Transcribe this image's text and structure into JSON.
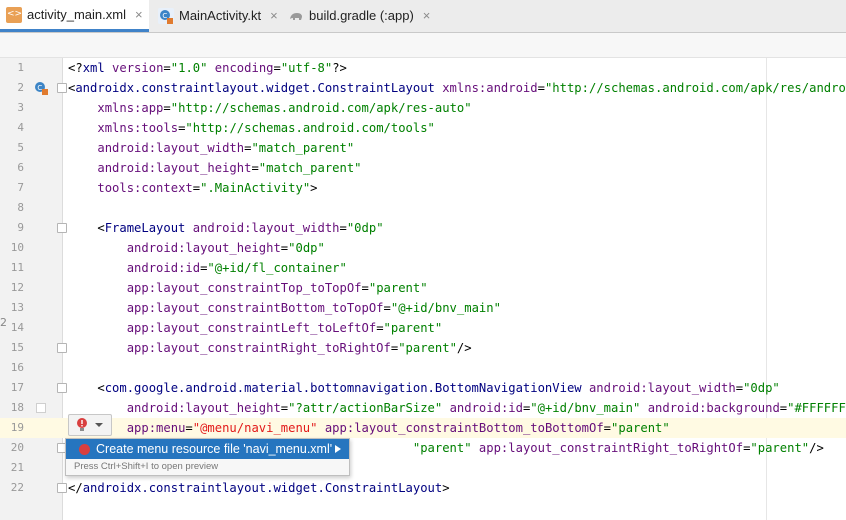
{
  "tabs": [
    {
      "label": "activity_main.xml",
      "icon": "xml-file-icon",
      "active": true
    },
    {
      "label": "MainActivity.kt",
      "icon": "kotlin-class-icon",
      "active": false
    },
    {
      "label": "build.gradle (:app)",
      "icon": "gradle-icon",
      "active": false
    }
  ],
  "close_glyph": "×",
  "lines": [
    {
      "n": "1",
      "tokens": [
        [
          "t",
          "<?"
        ],
        [
          "tag",
          "xml "
        ],
        [
          "attr",
          "version"
        ],
        [
          "t",
          "="
        ],
        [
          "val",
          "\"1.0\""
        ],
        [
          "t",
          " "
        ],
        [
          "attr",
          "encoding"
        ],
        [
          "t",
          "="
        ],
        [
          "val",
          "\"utf-8\""
        ],
        [
          "t",
          "?>"
        ]
      ]
    },
    {
      "n": "2",
      "tokens": [
        [
          "t",
          "<"
        ],
        [
          "tag",
          "androidx.constraintlayout.widget.ConstraintLayout "
        ],
        [
          "attr",
          "xmlns:android"
        ],
        [
          "t",
          "="
        ],
        [
          "val",
          "\"http://schemas.android.com/apk/res/android\""
        ]
      ]
    },
    {
      "n": "3",
      "tokens": [
        [
          "t",
          "    "
        ],
        [
          "attr",
          "xmlns:app"
        ],
        [
          "t",
          "="
        ],
        [
          "val",
          "\"http://schemas.android.com/apk/res-auto\""
        ]
      ]
    },
    {
      "n": "4",
      "tokens": [
        [
          "t",
          "    "
        ],
        [
          "attr",
          "xmlns:tools"
        ],
        [
          "t",
          "="
        ],
        [
          "val",
          "\"http://schemas.android.com/tools\""
        ]
      ]
    },
    {
      "n": "5",
      "tokens": [
        [
          "t",
          "    "
        ],
        [
          "attr",
          "android:layout_width"
        ],
        [
          "t",
          "="
        ],
        [
          "val",
          "\"match_parent\""
        ]
      ]
    },
    {
      "n": "6",
      "tokens": [
        [
          "t",
          "    "
        ],
        [
          "attr",
          "android:layout_height"
        ],
        [
          "t",
          "="
        ],
        [
          "val",
          "\"match_parent\""
        ]
      ]
    },
    {
      "n": "7",
      "tokens": [
        [
          "t",
          "    "
        ],
        [
          "attr",
          "tools:context"
        ],
        [
          "t",
          "="
        ],
        [
          "val",
          "\".MainActivity\""
        ],
        [
          "t",
          ">"
        ]
      ]
    },
    {
      "n": "8",
      "tokens": []
    },
    {
      "n": "9",
      "tokens": [
        [
          "t",
          "    <"
        ],
        [
          "tag",
          "FrameLayout "
        ],
        [
          "attr",
          "android:layout_width"
        ],
        [
          "t",
          "="
        ],
        [
          "val",
          "\"0dp\""
        ]
      ]
    },
    {
      "n": "10",
      "tokens": [
        [
          "t",
          "        "
        ],
        [
          "attr",
          "android:layout_height"
        ],
        [
          "t",
          "="
        ],
        [
          "val",
          "\"0dp\""
        ]
      ]
    },
    {
      "n": "11",
      "tokens": [
        [
          "t",
          "        "
        ],
        [
          "attr",
          "android:id"
        ],
        [
          "t",
          "="
        ],
        [
          "val",
          "\"@+id/fl_container\""
        ]
      ]
    },
    {
      "n": "12",
      "tokens": [
        [
          "t",
          "        "
        ],
        [
          "attr",
          "app:layout_constraintTop_toTopOf"
        ],
        [
          "t",
          "="
        ],
        [
          "val",
          "\"parent\""
        ]
      ]
    },
    {
      "n": "13",
      "tokens": [
        [
          "t",
          "        "
        ],
        [
          "attr",
          "app:layout_constraintBottom_toTopOf"
        ],
        [
          "t",
          "="
        ],
        [
          "val",
          "\"@+id/bnv_main\""
        ]
      ]
    },
    {
      "n": "14",
      "tokens": [
        [
          "t",
          "        "
        ],
        [
          "attr",
          "app:layout_constraintLeft_toLeftOf"
        ],
        [
          "t",
          "="
        ],
        [
          "val",
          "\"parent\""
        ]
      ]
    },
    {
      "n": "15",
      "tokens": [
        [
          "t",
          "        "
        ],
        [
          "attr",
          "app:layout_constraintRight_toRightOf"
        ],
        [
          "t",
          "="
        ],
        [
          "val",
          "\"parent\""
        ],
        [
          "t",
          "/>"
        ]
      ]
    },
    {
      "n": "16",
      "tokens": []
    },
    {
      "n": "17",
      "tokens": [
        [
          "t",
          "    <"
        ],
        [
          "tag",
          "com.google.android.material.bottomnavigation.BottomNavigationView "
        ],
        [
          "attr",
          "android:layout_width"
        ],
        [
          "t",
          "="
        ],
        [
          "val",
          "\"0dp\""
        ]
      ]
    },
    {
      "n": "18",
      "tokens": [
        [
          "t",
          "        "
        ],
        [
          "attr",
          "android:layout_height"
        ],
        [
          "t",
          "="
        ],
        [
          "val",
          "\"?attr/actionBarSize\""
        ],
        [
          "t",
          " "
        ],
        [
          "attr",
          "android:id"
        ],
        [
          "t",
          "="
        ],
        [
          "val",
          "\"@+id/bnv_main\""
        ],
        [
          "t",
          " "
        ],
        [
          "attr",
          "android:background"
        ],
        [
          "t",
          "="
        ],
        [
          "val",
          "\"#FFFFFF\""
        ]
      ]
    },
    {
      "n": "19",
      "tokens": [
        [
          "t",
          "        "
        ],
        [
          "attr",
          "app:menu"
        ],
        [
          "t",
          "="
        ],
        [
          "err",
          "\"@menu/navi_menu\""
        ],
        [
          "t",
          " "
        ],
        [
          "attr",
          "app:layout_constraintBottom_toBottomOf"
        ],
        [
          "t",
          "="
        ],
        [
          "val",
          "\"parent\""
        ]
      ]
    },
    {
      "n": "20",
      "tokens": [
        [
          "t",
          "                                               "
        ],
        [
          "val",
          "\"parent\""
        ],
        [
          "t",
          " "
        ],
        [
          "attr",
          "app:layout_constraintRight_toRightOf"
        ],
        [
          "t",
          "="
        ],
        [
          "val",
          "\"parent\""
        ],
        [
          "t",
          "/>"
        ]
      ]
    },
    {
      "n": "21",
      "tokens": []
    },
    {
      "n": "22",
      "tokens": [
        [
          "t",
          "</"
        ],
        [
          "tag",
          "androidx.constraintlayout.widget.ConstraintLayout"
        ],
        [
          "t",
          ">"
        ]
      ]
    }
  ],
  "popup": {
    "item_label": "Create menu resource file 'navi_menu.xml'",
    "hint": "Press Ctrl+Shift+I to open preview"
  },
  "side_mark": "2",
  "colors": {
    "tag": "#000080",
    "attribute": "#660e7a",
    "value": "#008000",
    "error": "#e21a1a",
    "current_line": "#fffae3",
    "selection": "#2675bf"
  }
}
